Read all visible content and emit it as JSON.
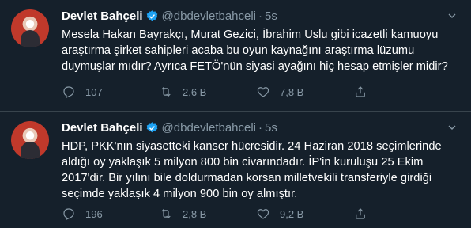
{
  "tweets": [
    {
      "author": {
        "name": "Devlet Bahçeli",
        "handle": "@dbdevletbahceli",
        "dot": "·",
        "time": "5s"
      },
      "text": "Mesela Hakan Bayrakçı, Murat Gezici, İbrahim Uslu gibi icazetli kamuoyu\naraştırma şirket sahipleri acaba bu oyun kaynağını araştırma lüzumu\nduymuşlar mıdır? Ayrıca FETÖ'nün siyasi ayağını hiç hesap etmişler midir?",
      "actions": {
        "replies": "107",
        "retweets": "2,6 B",
        "likes": "7,8 B"
      }
    },
    {
      "author": {
        "name": "Devlet Bahçeli",
        "handle": "@dbdevletbahceli",
        "dot": "·",
        "time": "5s"
      },
      "text": "HDP, PKK'nın siyasetteki kanser hücresidir. 24 Haziran 2018 seçimlerinde\naldığı oy yaklaşık 5 milyon 800 bin civarındadır. İP'in kuruluşu 25 Ekim\n2017'dir. Bir yılını bile doldurmadan korsan milletvekili transferiyle girdiği\nseçimde yaklaşık 4 milyon 900 bin oy almıştır.",
      "actions": {
        "replies": "196",
        "retweets": "2,8 B",
        "likes": "9,2 B"
      }
    }
  ],
  "colors": {
    "background": "#15202b",
    "muted": "#8899a6",
    "divider": "#38444d",
    "verified": "#1da1f2"
  },
  "icons": [
    "verified-icon",
    "caret-down-icon",
    "reply-icon",
    "retweet-icon",
    "like-icon",
    "share-icon"
  ]
}
